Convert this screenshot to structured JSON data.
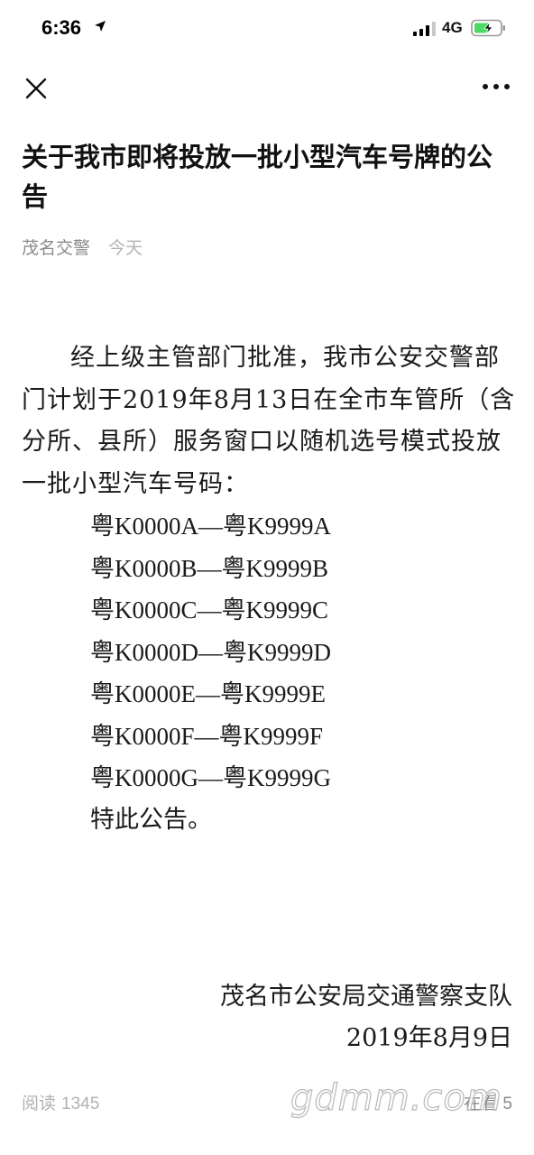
{
  "status_bar": {
    "time": "6:36",
    "network": "4G",
    "icons": [
      "location-arrow-icon",
      "signal-icon",
      "battery-charging-icon"
    ]
  },
  "nav": {
    "icons": [
      "close-icon",
      "more-icon"
    ]
  },
  "article": {
    "title": "关于我市即将投放一批小型汽车号牌的公告",
    "author": "茂名交警",
    "date": "今天",
    "body": "经上级主管部门批准，我市公安交警部门计划于2019年8月13日在全市车管所（含分所、县所）服务窗口以随机选号模式投放一批小型汽车号码：",
    "plates": [
      "粤K0000A—粤K9999A",
      "粤K0000B—粤K9999B",
      "粤K0000C—粤K9999C",
      "粤K0000D—粤K9999D",
      "粤K0000E—粤K9999E",
      "粤K0000F—粤K9999F",
      "粤K0000G—粤K9999G"
    ],
    "closing": "特此公告。",
    "signature_org": "茂名市公安局交通警察支队",
    "signature_date": "2019年8月9日"
  },
  "footer": {
    "read_label": "阅读",
    "read_count": "1345",
    "looking_partial": "在看 5"
  },
  "watermark": "gdmm.com",
  "colors": {
    "text": "#1a1a1a",
    "meta": "#8a8a8a",
    "footer": "#b2b2b2",
    "battery_green": "#4cd964"
  }
}
